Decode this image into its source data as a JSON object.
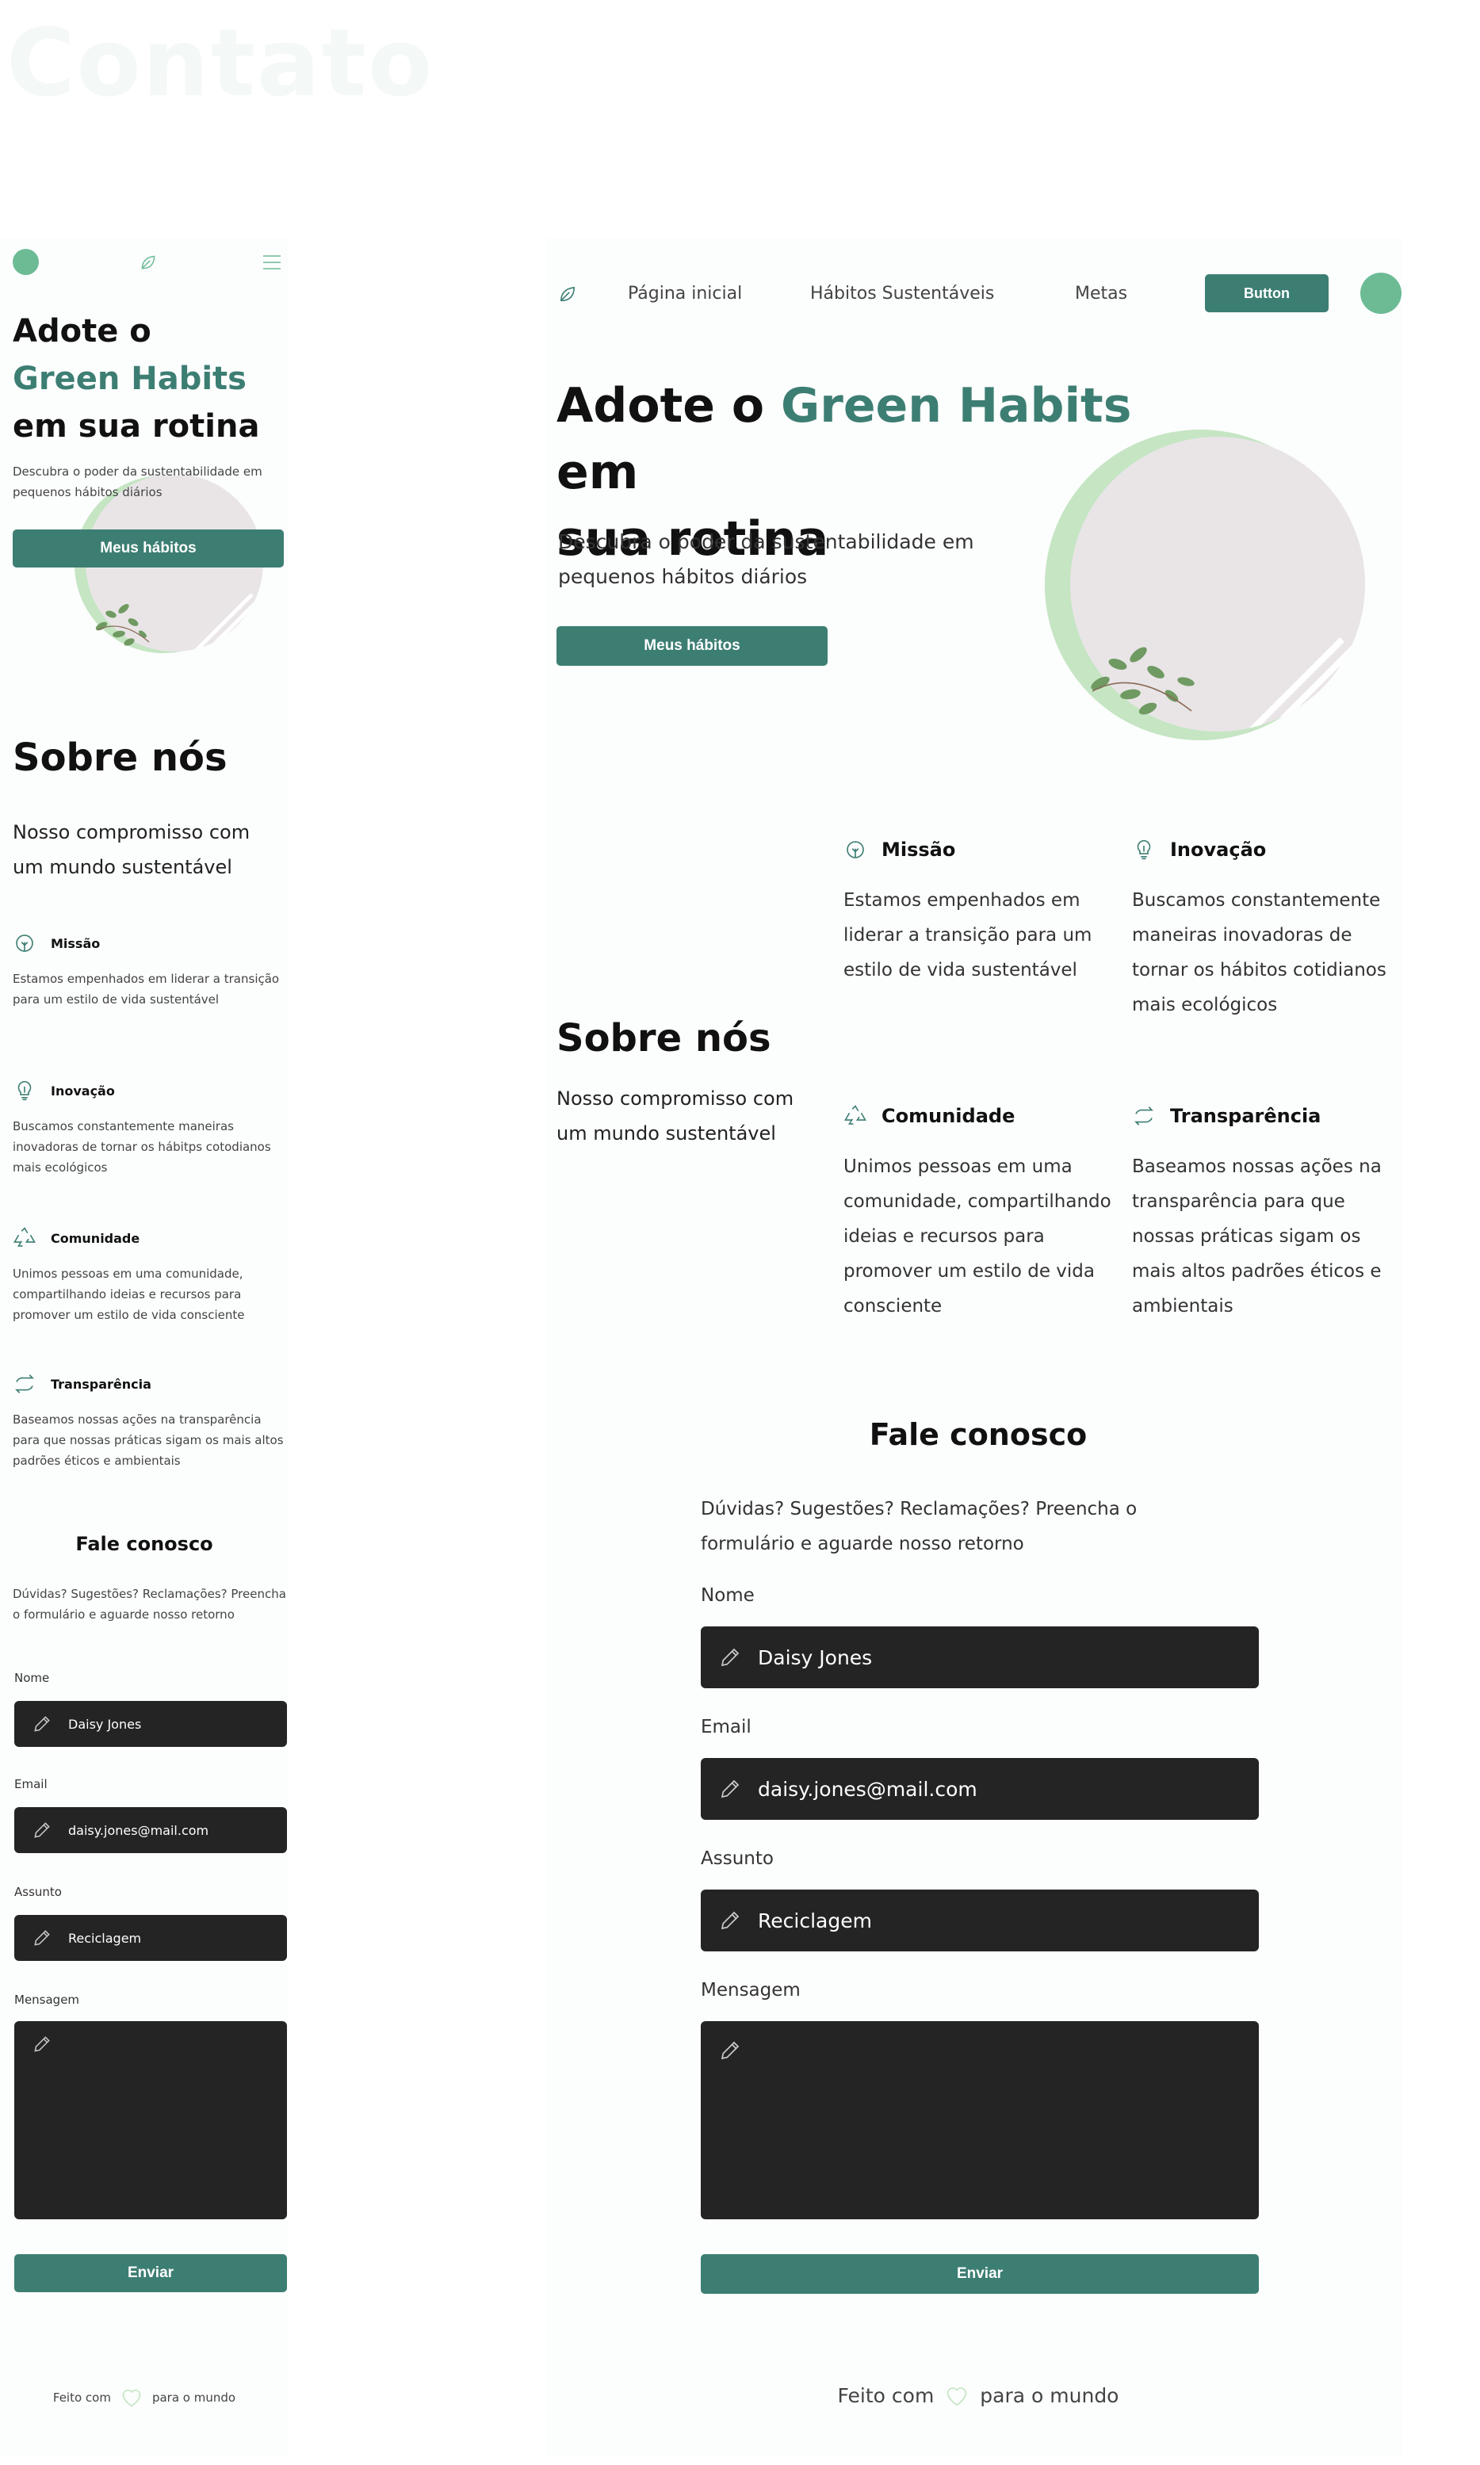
{
  "watermark": "Contato",
  "mobile": {
    "hero": {
      "title_line1": "Adote o",
      "title_line2": "Green Habits",
      "title_line3": "em sua rotina",
      "subtitle": "Descubra o poder da sustentabilidade em pequenos hábitos diários",
      "cta": "Meus hábitos"
    },
    "about": {
      "title": "Sobre nós",
      "subtitle": "Nosso compromisso com um mundo sustentável",
      "features": [
        {
          "title": "Missão",
          "text": "Estamos empenhados em liderar a transição para um estilo de vida sustentável"
        },
        {
          "title": "Inovação",
          "text": "Buscamos constantemente maneiras inovadoras de tornar os hábitps cotodianos mais ecológicos"
        },
        {
          "title": "Comunidade",
          "text": "Unimos pessoas em uma comunidade, compartilhando ideias e recursos para promover um estilo de vida consciente"
        },
        {
          "title": "Transparência",
          "text": "Baseamos nossas ações na transparência para que nossas práticas sigam os mais altos padrões éticos e ambientais"
        }
      ]
    },
    "contact": {
      "title": "Fale conosco",
      "subtitle": "Dúvidas? Sugestões? Reclamações? Preencha o formulário e aguarde nosso retorno",
      "name_label": "Nome",
      "name_value": "Daisy Jones",
      "email_label": "Email",
      "email_value": "daisy.jones@mail.com",
      "subject_label": "Assunto",
      "subject_value": "Reciclagem",
      "message_label": "Mensagem",
      "submit": "Enviar"
    },
    "footer": {
      "before": "Feito com",
      "after": "para o mundo"
    }
  },
  "desktop": {
    "nav": {
      "items": [
        "Página inicial",
        "Hábitos Sustentáveis",
        "Metas"
      ],
      "button": "Button"
    },
    "hero": {
      "title_a": "Adote o ",
      "title_green": "Green Habits",
      "title_b": " em",
      "title_line2": "sua rotina",
      "subtitle_line1": "Descubra o poder da sustentabilidade em",
      "subtitle_line2": "pequenos hábitos diários",
      "cta": "Meus hábitos"
    },
    "about": {
      "title": "Sobre nós",
      "subtitle_line1": "Nosso compromisso com",
      "subtitle_line2": "um mundo sustentável",
      "features": [
        {
          "title": "Missão",
          "text": "Estamos empenhados em liderar a transição para um estilo de vida sustentável"
        },
        {
          "title": "Inovação",
          "text": "Buscamos constantemente maneiras inovadoras de tornar os hábitos cotidianos mais ecológicos"
        },
        {
          "title": "Comunidade",
          "text": "Unimos pessoas em uma comunidade, compartilhando ideias e recursos para promover um estilo de vida consciente"
        },
        {
          "title": "Transparência",
          "text": "Baseamos nossas ações na transparência para que nossas práticas sigam os mais altos padrões éticos e ambientais"
        }
      ]
    },
    "contact": {
      "title": "Fale conosco",
      "subtitle_line1": "Dúvidas? Sugestões? Reclamações? Preencha o",
      "subtitle_line2": "formulário e aguarde nosso retorno",
      "name_label": "Nome",
      "name_value": "Daisy Jones",
      "email_label": "Email",
      "email_value": "daisy.jones@mail.com",
      "subject_label": "Assunto",
      "subject_value": "Reciclagem",
      "message_label": "Mensagem",
      "submit": "Enviar"
    },
    "footer": {
      "before": "Feito com",
      "after": "para o mundo"
    }
  },
  "colors": {
    "primary": "#3d7e73",
    "accent": "#6cbb95",
    "input_bg": "#242424",
    "hero_ring": "#c5e5c3"
  }
}
